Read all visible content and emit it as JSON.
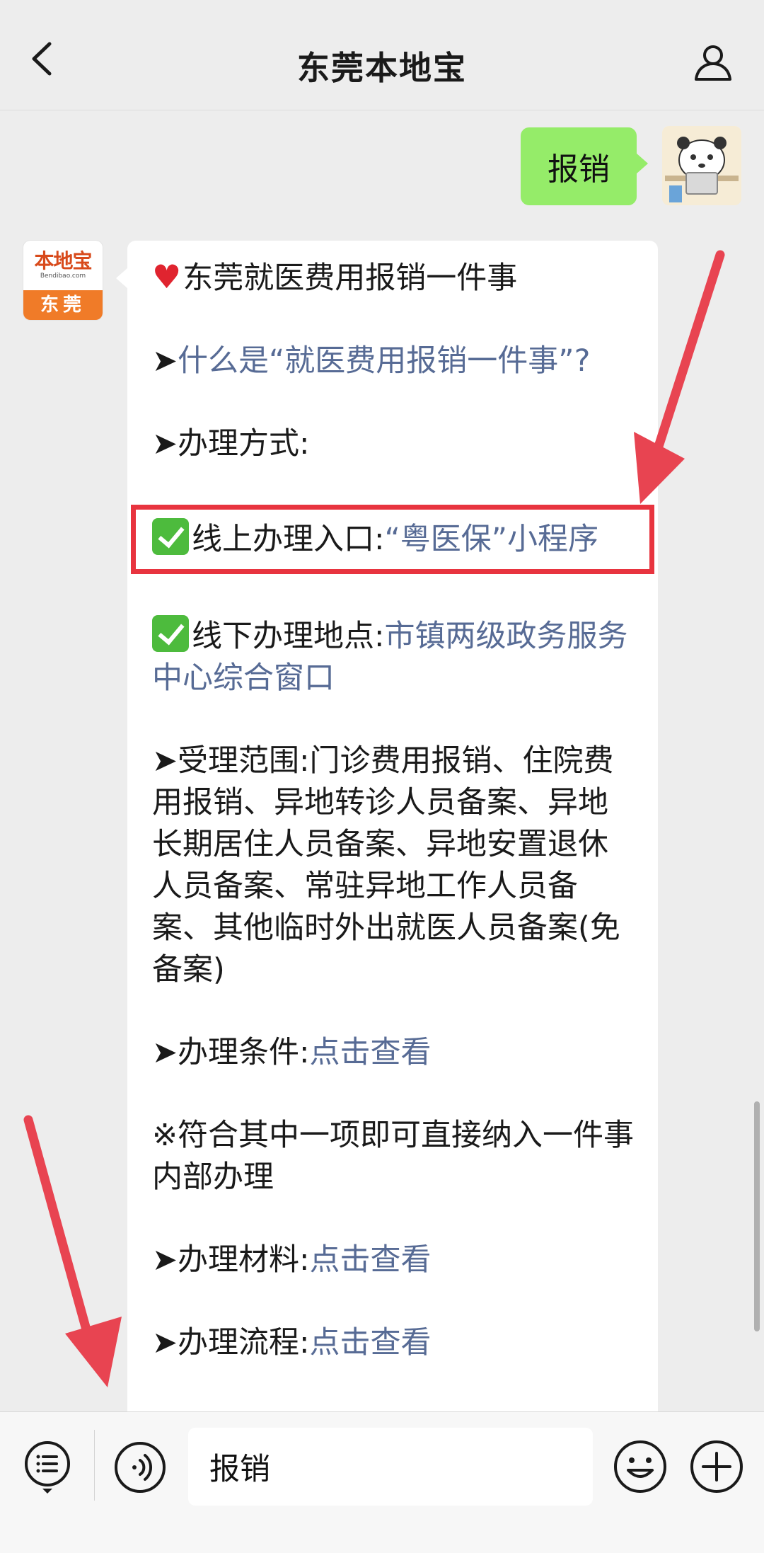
{
  "header": {
    "title": "东莞本地宝"
  },
  "user_message": {
    "text": "报销"
  },
  "bot": {
    "avatar": {
      "brand": "本地宝",
      "domain": "Bendibao.com",
      "city": "东莞"
    },
    "heading": "东莞就医费用报销一件事",
    "what_is_prefix": "➤",
    "what_is_link": "什么是“就医费用报销一件事”?",
    "method_label": "➤办理方式:",
    "online_label": "线上办理入口:",
    "online_link": "“粤医保”小程序",
    "offline_label": "线下办理地点:",
    "offline_link": "市镇两级政务服务中心综合窗口",
    "scope": "➤受理范围:门诊费用报销、住院费用报销、异地转诊人员备案、异地长期居住人员备案、异地安置退休人员备案、常驻异地工作人员备案、其他临时外出就医人员备案(免备案)",
    "conditions_label": "➤办理条件:",
    "conditions_link": "点击查看",
    "note": "※符合其中一项即可直接纳入一件事内部办理",
    "materials_label": "➤办理材料:",
    "materials_link": "点击查看",
    "process_label": "➤办理流程:",
    "process_link": "点击查看"
  },
  "input": {
    "value": "报销"
  },
  "colors": {
    "bubble_green": "#95ec69",
    "link": "#576b95",
    "highlight_red": "#e8343f",
    "arrow_red": "#e84451"
  }
}
